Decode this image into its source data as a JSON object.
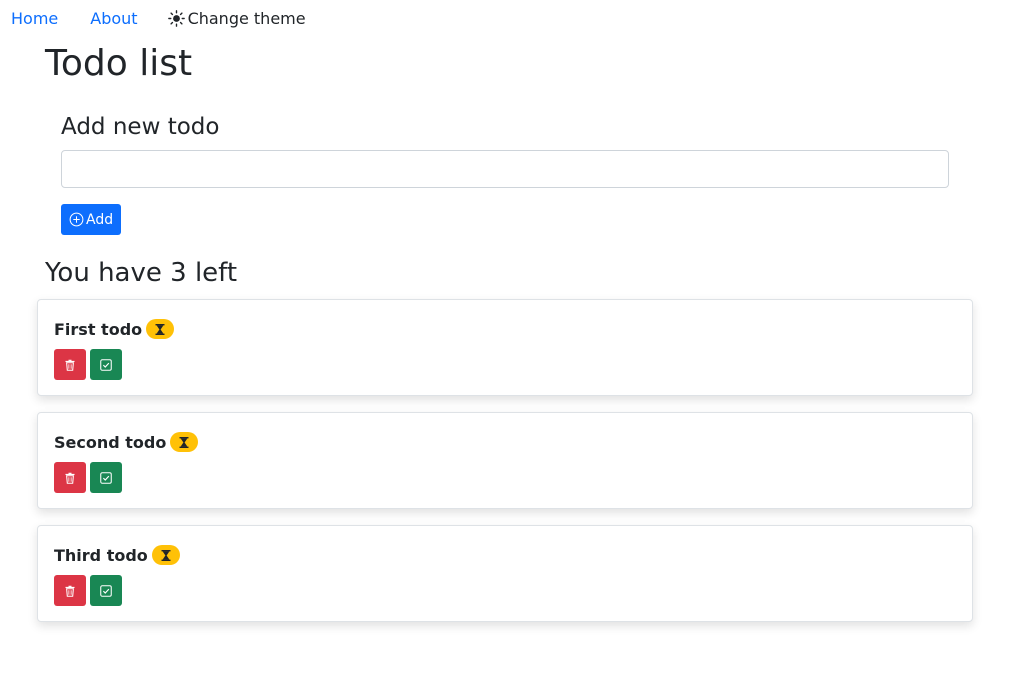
{
  "nav": {
    "home_label": "Home",
    "about_label": "About",
    "theme_label": "Change theme",
    "theme_icon": "sun-icon"
  },
  "page": {
    "title": "Todo list"
  },
  "add_form": {
    "heading": "Add new todo",
    "input_value": "",
    "input_placeholder": "",
    "button_label": "Add",
    "button_icon": "plus-circle-icon"
  },
  "summary": {
    "remaining_text": "You have 3 left"
  },
  "todos": [
    {
      "title": "First todo",
      "status_icon": "hourglass-icon"
    },
    {
      "title": "Second todo",
      "status_icon": "hourglass-icon"
    },
    {
      "title": "Third todo",
      "status_icon": "hourglass-icon"
    }
  ],
  "colors": {
    "link": "#0d6efd",
    "primary": "#0d6efd",
    "danger": "#dc3545",
    "success": "#198754",
    "warning": "#ffc107"
  }
}
